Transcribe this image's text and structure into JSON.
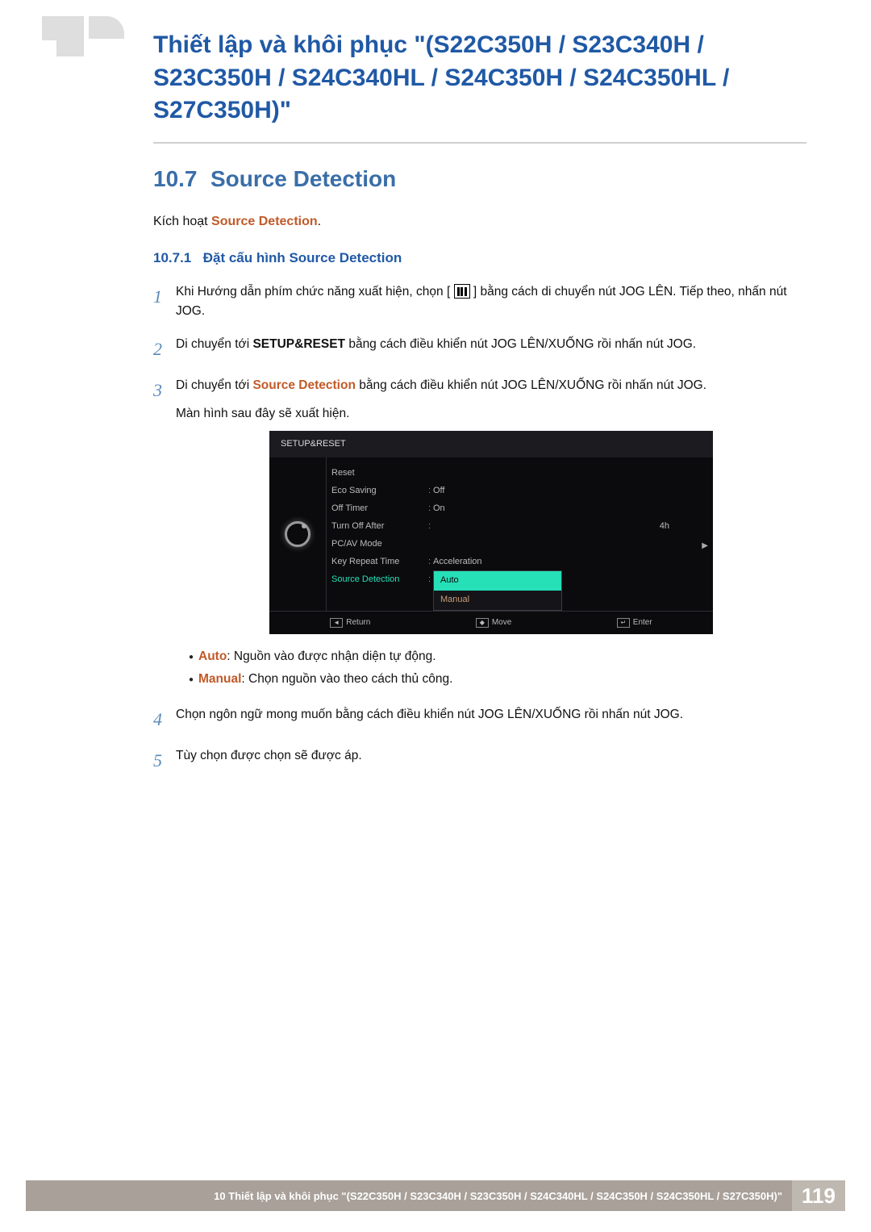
{
  "header": {
    "chapter_title": "Thiết lập và khôi phục \"(S22C350H / S23C340H / S23C350H / S24C340HL / S24C350H / S24C350HL / S27C350H)\""
  },
  "section": {
    "num": "10.7",
    "title": "Source Detection",
    "lead_prefix": "Kích hoạt ",
    "lead_accent": "Source Detection",
    "lead_suffix": "."
  },
  "subsection": {
    "num": "10.7.1",
    "title": "Đặt cấu hình Source Detection"
  },
  "steps": {
    "n1": "1",
    "s1a": "Khi Hướng dẫn phím chức năng xuất hiện, chọn [",
    "s1b": "] bằng cách di chuyển nút JOG LÊN. Tiếp theo, nhấn nút JOG.",
    "n2": "2",
    "s2a": "Di chuyển tới ",
    "s2b": "SETUP&RESET",
    "s2c": " bằng cách điều khiển nút JOG LÊN/XUỐNG rồi nhấn nút JOG.",
    "n3": "3",
    "s3a": "Di chuyển tới ",
    "s3b": "Source Detection",
    "s3c": " bằng cách điều khiển nút JOG LÊN/XUỐNG rồi nhấn nút JOG.",
    "s3d": "Màn hình sau đây sẽ xuất hiện.",
    "n4": "4",
    "s4": "Chọn ngôn ngữ mong muốn bằng cách điều khiển nút JOG LÊN/XUỐNG rồi nhấn nút JOG.",
    "n5": "5",
    "s5": "Tùy chọn được chọn sẽ được áp."
  },
  "bullets": {
    "b1_key": "Auto",
    "b1_text": ": Nguồn vào được nhận diện tự động.",
    "b2_key": "Manual",
    "b2_text": ": Chọn nguồn vào theo cách thủ công."
  },
  "osd": {
    "title": "SETUP&RESET",
    "rows": [
      {
        "key": "Reset",
        "sep": "",
        "val": ""
      },
      {
        "key": "Eco Saving",
        "sep": ":",
        "val": "Off"
      },
      {
        "key": "Off Timer",
        "sep": ":",
        "val": "On"
      },
      {
        "key": "Turn Off After",
        "sep": ":",
        "val": "4h"
      },
      {
        "key": "PC/AV Mode",
        "sep": "",
        "val": ""
      },
      {
        "key": "Key Repeat Time",
        "sep": ":",
        "val": "Acceleration"
      },
      {
        "key": "Source Detection",
        "sep": ":",
        "val": ""
      }
    ],
    "dropdown": {
      "sel": "Auto",
      "other": "Manual"
    },
    "footer": {
      "return": "Return",
      "move": "Move",
      "enter": "Enter"
    }
  },
  "footer": {
    "text": "10 Thiết lập và khôi phục \"(S22C350H / S23C340H / S23C350H / S24C340HL / S24C350H / S24C350HL / S27C350H)\"",
    "page": "119"
  }
}
